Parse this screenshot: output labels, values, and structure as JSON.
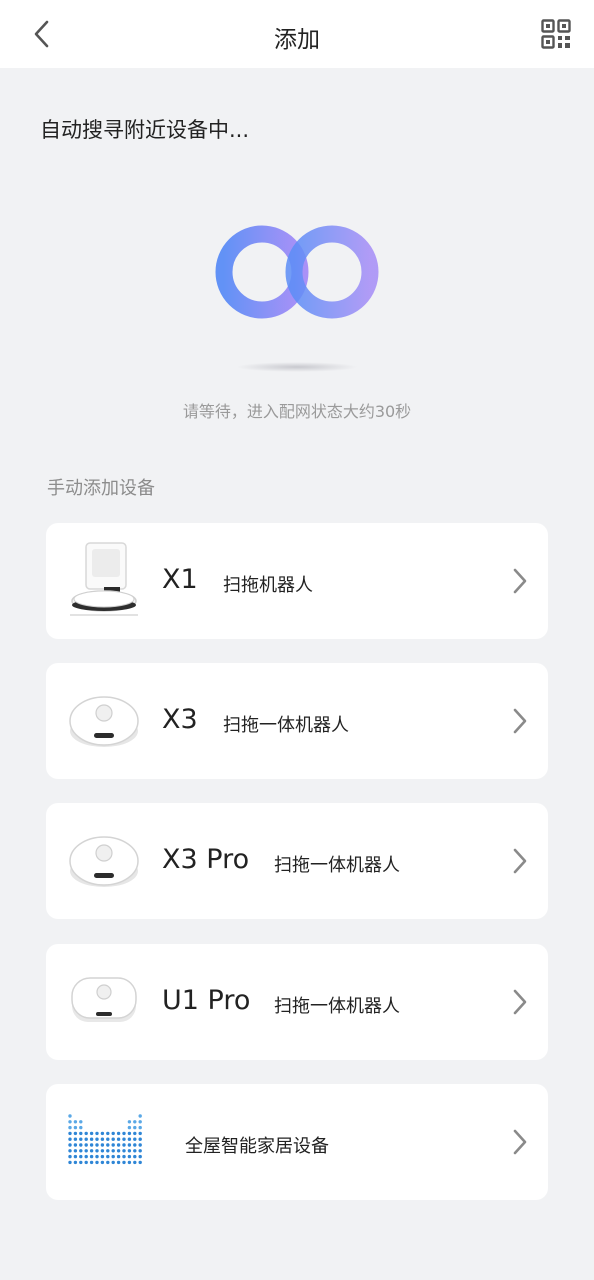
{
  "header": {
    "title": "添加",
    "back_icon": "chevron-left-icon",
    "qr_icon": "qr-code-icon"
  },
  "search": {
    "status": "自动搜寻附近设备中...",
    "wait_message": "请等待，进入配网状态大约30秒"
  },
  "manual": {
    "section_label": "手动添加设备",
    "devices": [
      {
        "model": "X1",
        "desc": "扫拖机器人",
        "icon": "robot-with-station-icon"
      },
      {
        "model": "X3",
        "desc": "扫拖一体机器人",
        "icon": "robot-vacuum-icon"
      },
      {
        "model": "X3 Pro",
        "desc": "扫拖一体机器人",
        "icon": "robot-vacuum-icon"
      },
      {
        "model": "U1 Pro",
        "desc": "扫拖一体机器人",
        "icon": "robot-vacuum-icon"
      }
    ],
    "smart_home": {
      "label": "全屋智能家居设备",
      "icon": "smart-home-logo-icon"
    }
  },
  "colors": {
    "accent_gradient_start": "#5b8df6",
    "accent_gradient_end": "#a58cf7",
    "background": "#f1f2f4",
    "card": "#ffffff"
  }
}
